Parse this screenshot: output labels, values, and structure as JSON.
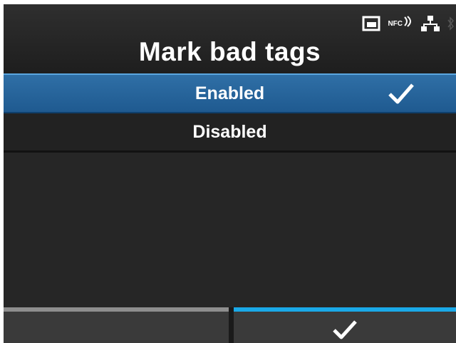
{
  "title": "Mark bad tags",
  "status_bar": {
    "icons": [
      "sd-card-icon",
      "nfc-icon",
      "network-icon",
      "bluetooth-icon"
    ],
    "nfc_label": "NFC"
  },
  "options": [
    {
      "label": "Enabled",
      "selected": true
    },
    {
      "label": "Disabled",
      "selected": false
    }
  ],
  "footer": {
    "left_key": "",
    "right_key_icon": "checkmark-icon"
  },
  "colors": {
    "selected_row": "#2a68a0",
    "right_key_accent": "#1aa9e8",
    "left_key_accent": "#8e8e8e",
    "background": "#262626"
  }
}
